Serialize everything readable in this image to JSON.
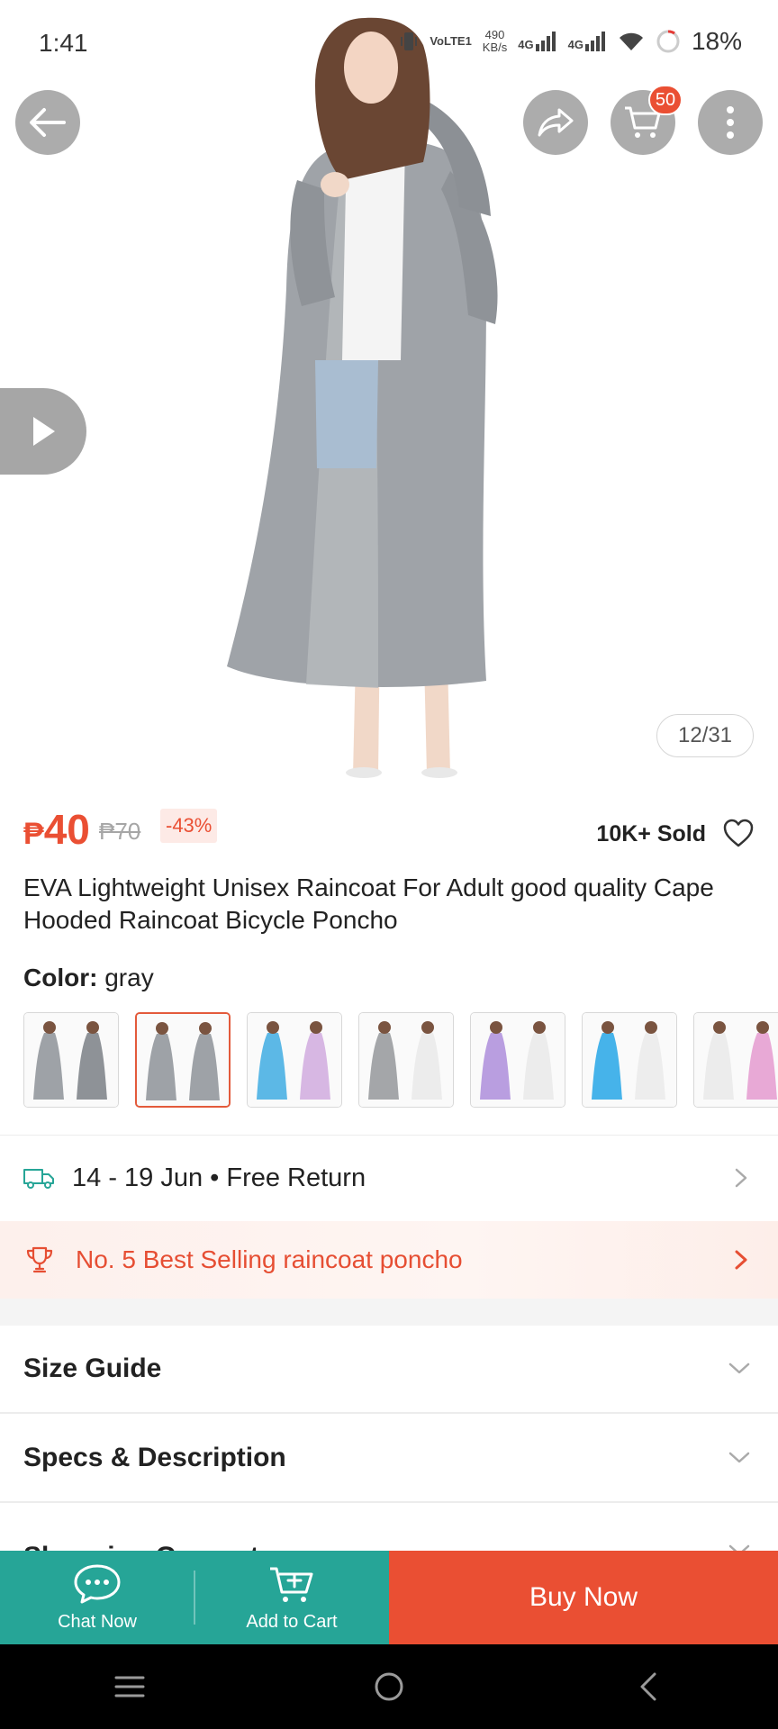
{
  "status_bar": {
    "time": "1:41",
    "network_label": "VoLTE1",
    "speed_value": "490",
    "speed_unit": "KB/s",
    "signal1": "4G",
    "signal2": "4G",
    "battery": "18%"
  },
  "header": {
    "back_icon": "arrow-left-icon",
    "share_icon": "share-icon",
    "cart_icon": "cart-icon",
    "cart_count": "50",
    "more_icon": "more-vertical-icon"
  },
  "gallery": {
    "counter": "12/31",
    "video_icon": "play-icon"
  },
  "product": {
    "currency": "₱",
    "price": "40",
    "original_price": "₱70",
    "discount": "-43%",
    "sold": "10K+ Sold",
    "title": "EVA Lightweight Unisex Raincoat For Adult  good quality Cape Hooded Raincoat Bicycle Poncho",
    "color_label": "Color:",
    "color_value": "gray",
    "selected_thumb_index": 1,
    "thumbs": [
      {
        "name": "gray-pair"
      },
      {
        "name": "gray-single"
      },
      {
        "name": "blue-white-mix"
      },
      {
        "name": "gray-white"
      },
      {
        "name": "purple-white"
      },
      {
        "name": "blue-white"
      },
      {
        "name": "white-pink"
      }
    ]
  },
  "delivery": {
    "text": "14 - 19 Jun • Free Return"
  },
  "best_selling": {
    "text": "No. 5 Best Selling raincoat poncho"
  },
  "accordions": [
    {
      "title": "Size Guide"
    },
    {
      "title": "Specs & Description"
    },
    {
      "title": "Shopping Guarantee"
    }
  ],
  "actions": {
    "chat_label": "Chat Now",
    "cart_label": "Add to Cart",
    "buy_label": "Buy Now"
  },
  "colors": {
    "accent": "#ea4f33",
    "teal": "#26a597"
  }
}
